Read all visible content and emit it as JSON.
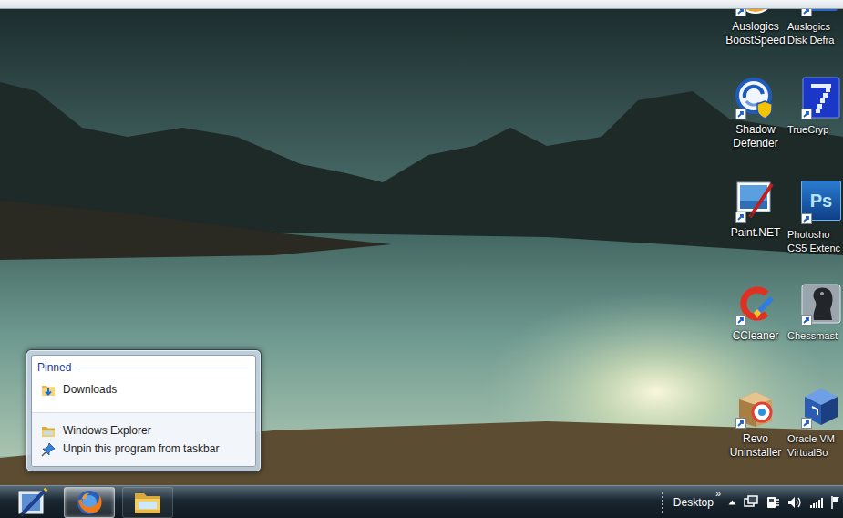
{
  "desktop": {
    "icons": [
      {
        "lines": [
          "Auslogics",
          "BoostSpeed"
        ]
      },
      {
        "lines": [
          "Auslogics",
          "Disk Defra"
        ]
      },
      {
        "lines": [
          "Shadow",
          "Defender"
        ]
      },
      {
        "lines": [
          "TrueCryp"
        ]
      },
      {
        "lines": [
          "Paint.NET"
        ]
      },
      {
        "lines": [
          "Photosho",
          "CS5 Extenc"
        ],
        "logo_text": "Ps"
      },
      {
        "lines": [
          "CCleaner"
        ]
      },
      {
        "lines": [
          "Chessmast"
        ]
      },
      {
        "lines": [
          "Revo",
          "Uninstaller"
        ]
      },
      {
        "lines": [
          "Oracle VM",
          "VirtualBo"
        ]
      }
    ]
  },
  "jump_list": {
    "section": "Pinned",
    "pinned": [
      {
        "label": "Downloads"
      }
    ],
    "tasks": [
      {
        "label": "Windows Explorer",
        "kind": "app"
      },
      {
        "label": "Unpin this program from taskbar",
        "kind": "unpin"
      }
    ]
  },
  "taskbar": {
    "buttons": [
      {
        "highlighted": true
      },
      {
        "highlighted": false
      }
    ],
    "toolbar": {
      "label": "Desktop",
      "more": "»"
    }
  }
}
